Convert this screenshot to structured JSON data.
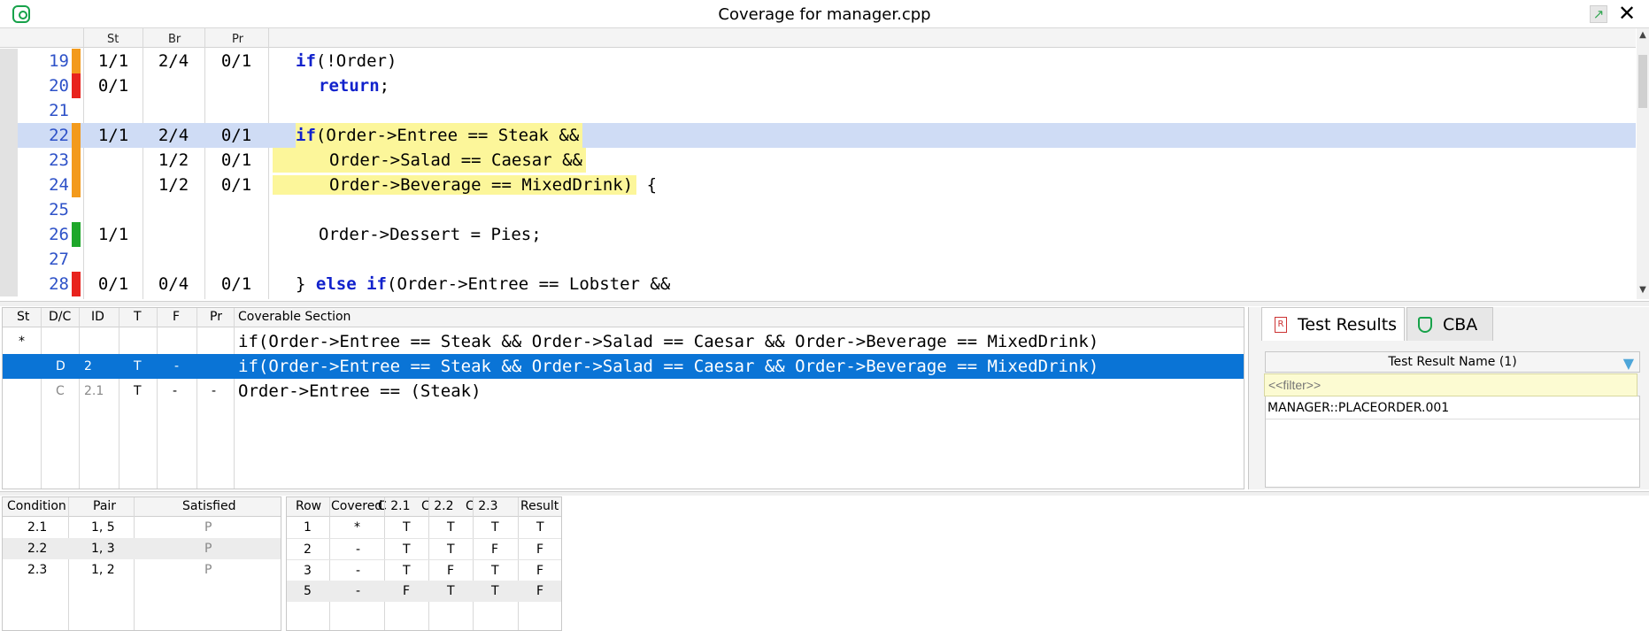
{
  "window": {
    "title": "Coverage for manager.cpp"
  },
  "code_header": {
    "st": "St",
    "br": "Br",
    "pr": "Pr"
  },
  "code_lines": [
    {
      "num": "19",
      "st": "1/1",
      "br": "2/4",
      "pr": "0/1",
      "mark": "#f39a1c",
      "text": "if(!Order)",
      "indent": "  "
    },
    {
      "num": "20",
      "st": "0/1",
      "br": "",
      "pr": "",
      "mark": "#e8231e",
      "text": "return;",
      "indent": "    "
    },
    {
      "num": "21",
      "st": "",
      "br": "",
      "pr": "",
      "mark": "",
      "text": "",
      "indent": ""
    },
    {
      "num": "22",
      "st": "1/1",
      "br": "2/4",
      "pr": "0/1",
      "mark": "#f39a1c",
      "text": "if(Order->Entree == Steak &&",
      "indent": "  "
    },
    {
      "num": "23",
      "st": "",
      "br": "1/2",
      "pr": "0/1",
      "mark": "#f39a1c",
      "text": "Order->Salad == Caesar &&",
      "indent": "     "
    },
    {
      "num": "24",
      "st": "",
      "br": "1/2",
      "pr": "0/1",
      "mark": "#f39a1c",
      "text": "Order->Beverage == MixedDrink) {",
      "indent": "     "
    },
    {
      "num": "25",
      "st": "",
      "br": "",
      "pr": "",
      "mark": "",
      "text": "",
      "indent": ""
    },
    {
      "num": "26",
      "st": "1/1",
      "br": "",
      "pr": "",
      "mark": "#1ea72a",
      "text": "Order->Dessert = Pies;",
      "indent": "    "
    },
    {
      "num": "27",
      "st": "",
      "br": "",
      "pr": "",
      "mark": "",
      "text": "",
      "indent": ""
    },
    {
      "num": "28",
      "st": "0/1",
      "br": "0/4",
      "pr": "0/1",
      "mark": "#e8231e",
      "text": "} else if(Order->Entree == Lobster &&",
      "indent": "  "
    }
  ],
  "sections": {
    "headers": {
      "st": "St",
      "dc": "D/C",
      "id": "ID",
      "t": "T",
      "f": "F",
      "pr": "Pr",
      "section": "Coverable Section"
    },
    "rows": [
      {
        "st": "*",
        "dc": "",
        "id": "",
        "t": "",
        "f": "",
        "pr": "",
        "section": "if(Order->Entree == Steak && Order->Salad == Caesar && Order->Beverage == MixedDrink)"
      },
      {
        "st": "",
        "dc": "D",
        "id": "2",
        "t": "T",
        "f": "-",
        "pr": "",
        "section": "if(Order->Entree == Steak && Order->Salad == Caesar && Order->Beverage == MixedDrink)"
      },
      {
        "st": "",
        "dc": "C",
        "id": "2.1",
        "t": "T",
        "f": "-",
        "pr": "-",
        "section": "Order->Entree == (Steak)"
      }
    ]
  },
  "right_panel": {
    "tabs": [
      {
        "label": "Test Results"
      },
      {
        "label": "CBA"
      }
    ],
    "column_header": "Test Result Name (1)",
    "filter_placeholder": "<<filter>>",
    "results": [
      "MANAGER::PLACEORDER.001"
    ]
  },
  "conditions": {
    "headers": {
      "condition": "Condition",
      "pair": "Pair",
      "satisfied": "Satisfied"
    },
    "rows": [
      {
        "condition": "2.1",
        "pair": "1, 5",
        "satisfied": "P"
      },
      {
        "condition": "2.2",
        "pair": "1, 3",
        "satisfied": "P"
      },
      {
        "condition": "2.3",
        "pair": "1, 2",
        "satisfied": "P"
      }
    ]
  },
  "truth_table": {
    "headers": {
      "row": "Row",
      "covered": "Covered",
      "c21": "C 2.1",
      "c22": "C 2.2",
      "c23": "C 2.3",
      "result": "Result"
    },
    "rows": [
      {
        "row": "1",
        "covered": "*",
        "c21": "T",
        "c22": "T",
        "c23": "T",
        "result": "T"
      },
      {
        "row": "2",
        "covered": "-",
        "c21": "T",
        "c22": "T",
        "c23": "F",
        "result": "F"
      },
      {
        "row": "3",
        "covered": "-",
        "c21": "T",
        "c22": "F",
        "c23": "T",
        "result": "F"
      },
      {
        "row": "5",
        "covered": "-",
        "c21": "F",
        "c22": "T",
        "c23": "T",
        "result": "F"
      }
    ]
  },
  "icons": {
    "app": "vcast-shield-icon",
    "popout": "popout-icon",
    "close": "close-icon",
    "filter": "filter-icon"
  }
}
